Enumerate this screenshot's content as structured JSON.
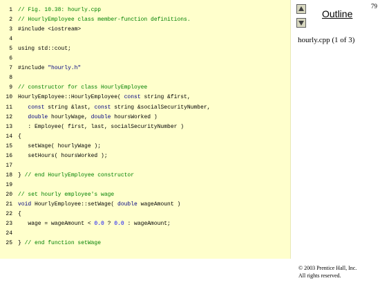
{
  "slide": {
    "page_number": "79",
    "outline_label": "Outline",
    "file_label": "hourly.cpp (1 of 3)",
    "copyright_line1": "© 2003 Prentice Hall, Inc.",
    "copyright_line2": "All rights reserved."
  },
  "nav": {
    "up_icon": "triangle-up-icon",
    "down_icon": "triangle-down-icon"
  },
  "colors": {
    "panel_bg": "#ffffcc",
    "comment": "#008000",
    "keyword": "#000080",
    "number": "#0000ff"
  },
  "code": {
    "lines": [
      {
        "num": "1",
        "segments": [
          {
            "t": "// Fig. 10.38: hourly.cpp",
            "c": "comment"
          }
        ]
      },
      {
        "num": "2",
        "segments": [
          {
            "t": "// HourlyEmployee class member-function definitions.",
            "c": "comment"
          }
        ]
      },
      {
        "num": "3",
        "segments": [
          {
            "t": "#include <iostream>",
            "c": "plain"
          }
        ]
      },
      {
        "num": "4",
        "segments": [
          {
            "t": "",
            "c": "plain"
          }
        ]
      },
      {
        "num": "5",
        "segments": [
          {
            "t": "using std::cout;",
            "c": "plain"
          }
        ]
      },
      {
        "num": "6",
        "segments": [
          {
            "t": "",
            "c": "plain"
          }
        ]
      },
      {
        "num": "7",
        "segments": [
          {
            "t": "#include ",
            "c": "plain"
          },
          {
            "t": "\"hourly.h\"",
            "c": "string"
          }
        ]
      },
      {
        "num": "8",
        "segments": [
          {
            "t": "",
            "c": "plain"
          }
        ]
      },
      {
        "num": "9",
        "segments": [
          {
            "t": "// constructor for class HourlyEmployee",
            "c": "comment"
          }
        ]
      },
      {
        "num": "10",
        "segments": [
          {
            "t": "HourlyEmployee::HourlyEmployee( ",
            "c": "plain"
          },
          {
            "t": "const",
            "c": "keyword"
          },
          {
            "t": " string &first,",
            "c": "plain"
          }
        ]
      },
      {
        "num": "11",
        "segments": [
          {
            "t": "   ",
            "c": "plain"
          },
          {
            "t": "const",
            "c": "keyword"
          },
          {
            "t": " string &last, ",
            "c": "plain"
          },
          {
            "t": "const",
            "c": "keyword"
          },
          {
            "t": " string &socialSecurityNumber,",
            "c": "plain"
          }
        ]
      },
      {
        "num": "12",
        "segments": [
          {
            "t": "   ",
            "c": "plain"
          },
          {
            "t": "double",
            "c": "keyword"
          },
          {
            "t": " hourlyWage, ",
            "c": "plain"
          },
          {
            "t": "double",
            "c": "keyword"
          },
          {
            "t": " hoursWorked )",
            "c": "plain"
          }
        ]
      },
      {
        "num": "13",
        "segments": [
          {
            "t": "   : Employee( first, last, socialSecurityNumber )",
            "c": "plain"
          }
        ]
      },
      {
        "num": "14",
        "segments": [
          {
            "t": "{",
            "c": "plain"
          }
        ]
      },
      {
        "num": "15",
        "segments": [
          {
            "t": "   setWage( hourlyWage );",
            "c": "plain"
          }
        ]
      },
      {
        "num": "16",
        "segments": [
          {
            "t": "   setHours( hoursWorked );",
            "c": "plain"
          }
        ]
      },
      {
        "num": "17",
        "segments": [
          {
            "t": "",
            "c": "plain"
          }
        ]
      },
      {
        "num": "18",
        "segments": [
          {
            "t": "} ",
            "c": "plain"
          },
          {
            "t": "// end HourlyEmployee constructor",
            "c": "comment"
          }
        ]
      },
      {
        "num": "19",
        "segments": [
          {
            "t": "",
            "c": "plain"
          }
        ]
      },
      {
        "num": "20",
        "segments": [
          {
            "t": "// set hourly employee's wage",
            "c": "comment"
          }
        ]
      },
      {
        "num": "21",
        "segments": [
          {
            "t": "void",
            "c": "keyword"
          },
          {
            "t": " HourlyEmployee::setWage( ",
            "c": "plain"
          },
          {
            "t": "double",
            "c": "keyword"
          },
          {
            "t": " wageAmount )",
            "c": "plain"
          }
        ]
      },
      {
        "num": "22",
        "segments": [
          {
            "t": "{",
            "c": "plain"
          }
        ]
      },
      {
        "num": "23",
        "segments": [
          {
            "t": "   wage = wageAmount < ",
            "c": "plain"
          },
          {
            "t": "0.0",
            "c": "number"
          },
          {
            "t": " ? ",
            "c": "plain"
          },
          {
            "t": "0.0",
            "c": "number"
          },
          {
            "t": " : wageAmount;",
            "c": "plain"
          }
        ]
      },
      {
        "num": "24",
        "segments": [
          {
            "t": "",
            "c": "plain"
          }
        ]
      },
      {
        "num": "25",
        "segments": [
          {
            "t": "} ",
            "c": "plain"
          },
          {
            "t": "// end function setWage",
            "c": "comment"
          }
        ]
      }
    ]
  }
}
